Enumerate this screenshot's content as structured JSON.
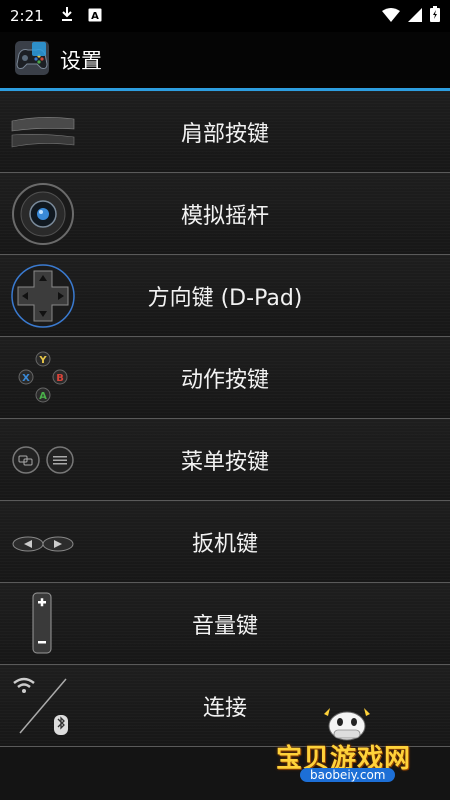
{
  "status_bar": {
    "time": "2:21",
    "icons": [
      "download-icon",
      "keyboard-a-icon",
      "wifi-icon",
      "signal-icon",
      "battery-icon"
    ]
  },
  "app_bar": {
    "title": "设置",
    "app_icon": "gamepad-app-icon"
  },
  "accent_color": "#2d9ee0",
  "settings_items": [
    {
      "label": "肩部按键",
      "icon": "shoulder-buttons-icon"
    },
    {
      "label": "模拟摇杆",
      "icon": "analog-stick-icon"
    },
    {
      "label": "方向键 (D-Pad)",
      "icon": "dpad-icon"
    },
    {
      "label": "动作按键",
      "icon": "action-buttons-icon"
    },
    {
      "label": "菜单按键",
      "icon": "menu-buttons-icon"
    },
    {
      "label": "扳机键",
      "icon": "trigger-icon"
    },
    {
      "label": "音量键",
      "icon": "volume-key-icon"
    },
    {
      "label": "连接",
      "icon": "connection-icon"
    }
  ],
  "watermark": {
    "title": "宝贝游戏网",
    "url": "baobeiy.com"
  }
}
